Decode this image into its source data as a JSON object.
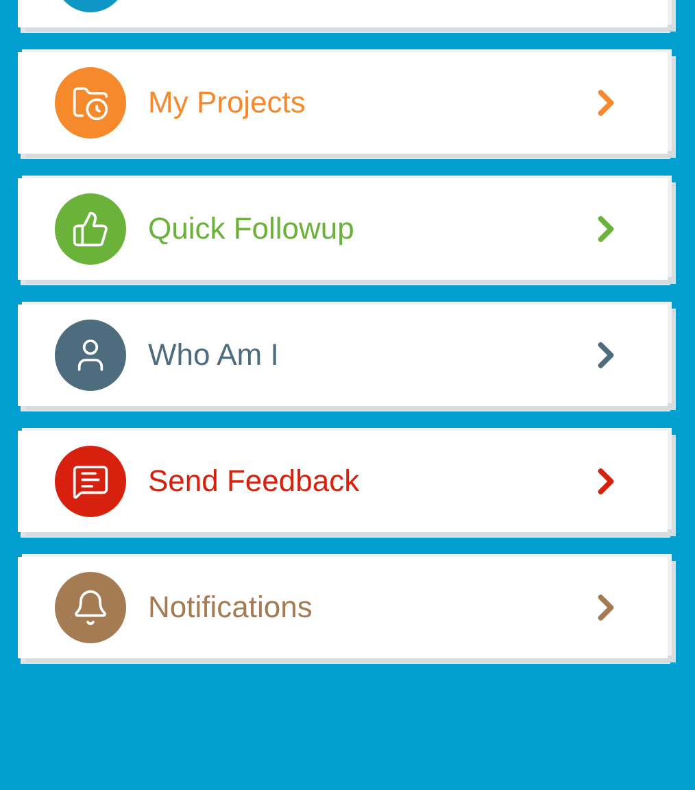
{
  "partial_item": {
    "color": "#0e97c6"
  },
  "menu_items": [
    {
      "label": "My Projects",
      "color": "#f5892c"
    },
    {
      "label": "Quick Followup",
      "color": "#6ab23a"
    },
    {
      "label": "Who Am I",
      "color": "#4d6c7e"
    },
    {
      "label": "Send Feedback",
      "color": "#d8200e"
    },
    {
      "label": "Notifications",
      "color": "#a47b52"
    }
  ]
}
